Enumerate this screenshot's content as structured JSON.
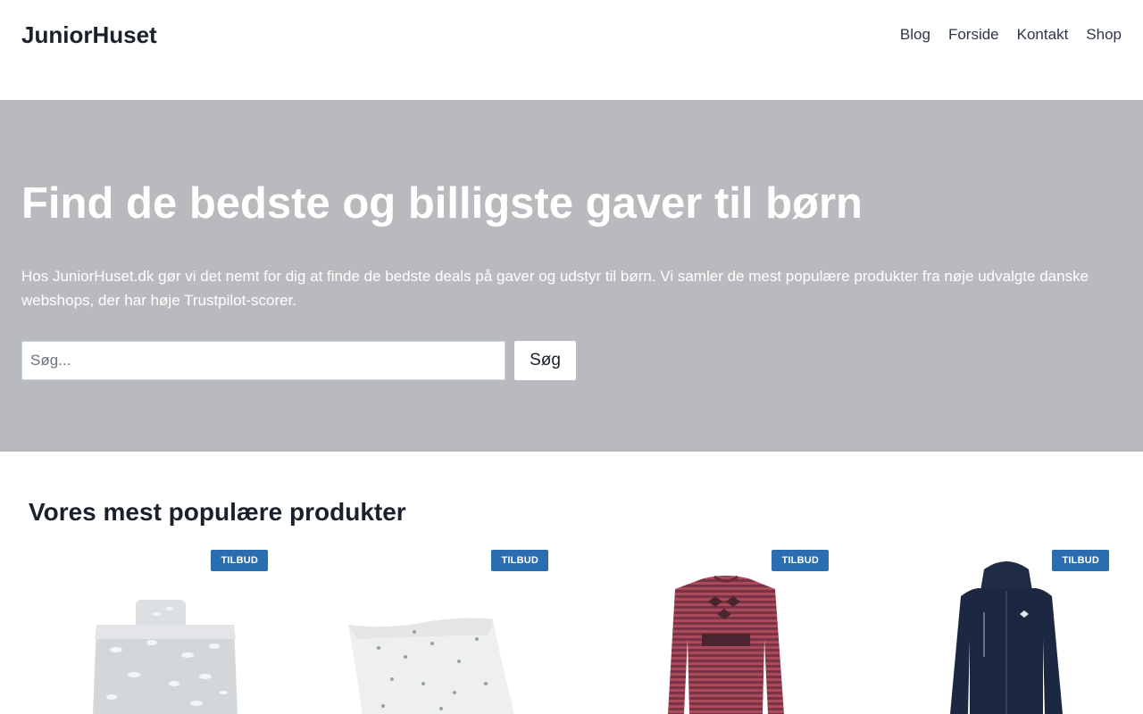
{
  "header": {
    "logo": "JuniorHuset",
    "nav": [
      "Blog",
      "Forside",
      "Kontakt",
      "Shop"
    ]
  },
  "hero": {
    "title": "Find de bedste og billigste gaver til børn",
    "text": "Hos JuniorHuset.dk gør vi det nemt for dig at finde de bedste deals på gaver og udstyr til børn. Vi samler de mest populære produkter fra nøje udvalgte danske webshops, der har høje Trustpilot-scorer.",
    "search_placeholder": "Søg...",
    "search_button": "Søg"
  },
  "products_section": {
    "title": "Vores mest populære produkter",
    "items": [
      {
        "badge": "TILBUD",
        "image": "bedding-clouds"
      },
      {
        "badge": "TILBUD",
        "image": "pillow-floral"
      },
      {
        "badge": "TILBUD",
        "image": "striped-shirt-hummel"
      },
      {
        "badge": "TILBUD",
        "image": "navy-jacket-hummel"
      }
    ]
  },
  "colors": {
    "hero_bg": "#b9babe",
    "badge_bg": "#2a6db0"
  }
}
